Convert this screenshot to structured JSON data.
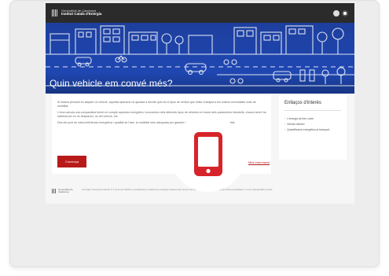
{
  "header": {
    "org_line1": "Generalitat de Catalunya",
    "org_line2": "Institut Català d'Energia"
  },
  "hero": {
    "title": "Quin vehicle em convé més?"
  },
  "main": {
    "paragraphs": [
      "Si estava pensant en adquirir un vehicle, aquesta aplicació us ajudarà a decidir quin és el tipus de vehicle que millor s'adapta a les vostres necessitats reals de mobilitat.",
      "L'eina calcula una comparativa tenint en compte aspectes energètics i econòmics dels diferents tipus de vehicles en funció dels paràmetres introduïts, d'acord amb l'ús habitual per en us desplaceu, ús del vehicle, etc.",
      "Des del punt de vista d'eficiència energètica i qualitat de l'aire, la mobilitat més adequada per garantir una mobilitat energèticament sostenible."
    ],
    "start_button": "Comença",
    "more_link": "Més informació"
  },
  "sidebar": {
    "title": "Enllaços d'interès",
    "links": [
      "L'energia del teu cotxe",
      "Vehicle elèctric",
      "Quantificació energètica al transport"
    ]
  },
  "footer": {
    "logo_text": "Generalitat de Catalunya",
    "text": "Avís legal: D'acord amb l'article 17.1 de la Llei 19/2014, la ciutadania pot reutilitzar els continguts d'aquest web sempre que se'n citi la font i s'indiqui la data de l'última actualització, i no se'n desnaturalitzi el sentit."
  },
  "colors": {
    "accent": "#b81a1a",
    "hero_blue": "#1f47b2",
    "phone_red": "#d6242a"
  }
}
